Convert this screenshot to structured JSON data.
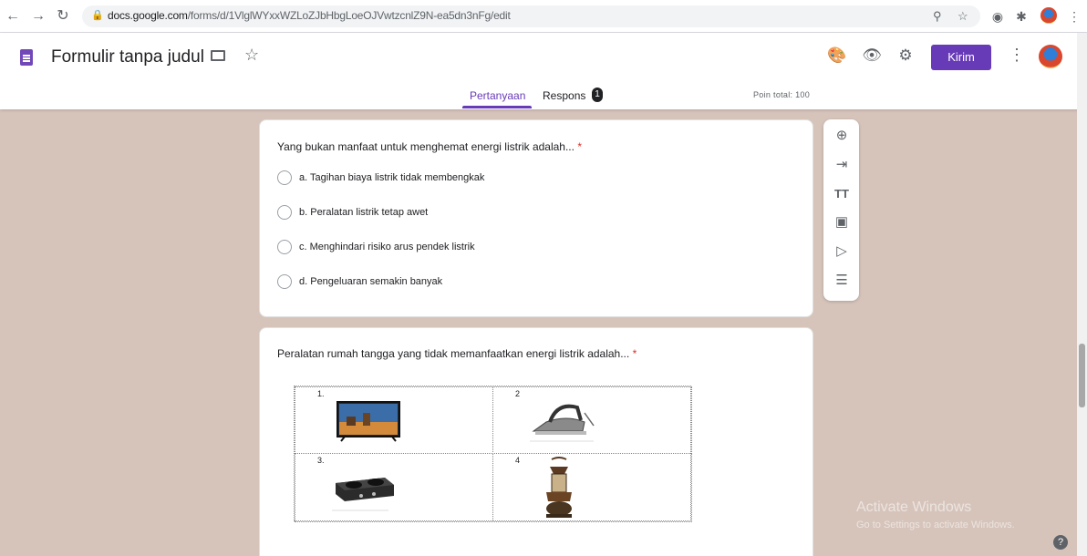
{
  "browser": {
    "url_host": "docs.google.com",
    "url_path": "/forms/d/1VlglWYxxWZLoZJbHbgLoeOJVwtzcnlZ9N-ea5dn3nFg/edit"
  },
  "header": {
    "title": "Formulir tanpa judul",
    "send_label": "Kirim",
    "tabs": [
      {
        "label": "Pertanyaan"
      },
      {
        "label": "Respons",
        "badge": "1"
      }
    ],
    "points": "Poin total: 100"
  },
  "questions": [
    {
      "text": "Yang bukan manfaat untuk menghemat energi listrik adalah...",
      "required_mark": "*",
      "options": [
        "a. Tagihan biaya listrik tidak membengkak",
        "b. Peralatan listrik tetap awet",
        "c. Menghindari risiko arus pendek listrik",
        "d. Pengeluaran semakin banyak"
      ]
    },
    {
      "text": "Peralatan rumah tangga yang tidak memanfaatkan energi listrik adalah...",
      "required_mark": "*",
      "image_labels": [
        "1.",
        "2",
        "3.",
        "4"
      ]
    }
  ],
  "watermark": {
    "line1": "Activate Windows",
    "line2": "Go to Settings to activate Windows."
  },
  "help": "?"
}
